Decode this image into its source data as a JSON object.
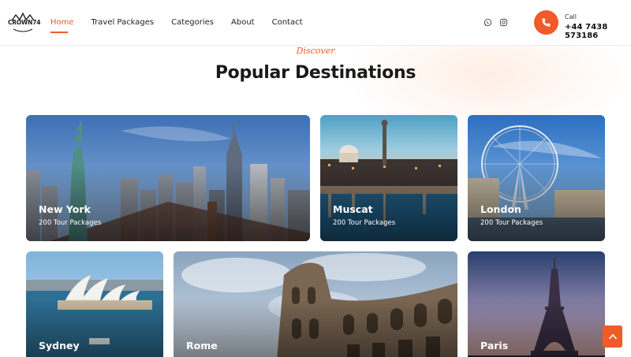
{
  "brand": {
    "logo_text": "CROWN74"
  },
  "nav": {
    "items": [
      {
        "label": "Home",
        "active": true
      },
      {
        "label": "Travel Packages",
        "active": false
      },
      {
        "label": "Categories",
        "active": false
      },
      {
        "label": "About",
        "active": false
      },
      {
        "label": "Contact",
        "active": false
      }
    ]
  },
  "social": {
    "icons": [
      "whatsapp-icon",
      "instagram-icon"
    ]
  },
  "contact": {
    "call_label": "Call",
    "phone": "+44 7438 573186"
  },
  "hero": {
    "eyebrow": "Discover",
    "title": "Popular Destinations"
  },
  "destinations": [
    {
      "city": "New York",
      "packages": "200 Tour Packages"
    },
    {
      "city": "Muscat",
      "packages": "200 Tour Packages"
    },
    {
      "city": "London",
      "packages": "200 Tour Packages"
    },
    {
      "city": "Sydney",
      "packages": ""
    },
    {
      "city": "Rome",
      "packages": ""
    },
    {
      "city": "Paris",
      "packages": ""
    }
  ],
  "colors": {
    "accent": "#f15a29",
    "text": "#1a1a1a"
  }
}
